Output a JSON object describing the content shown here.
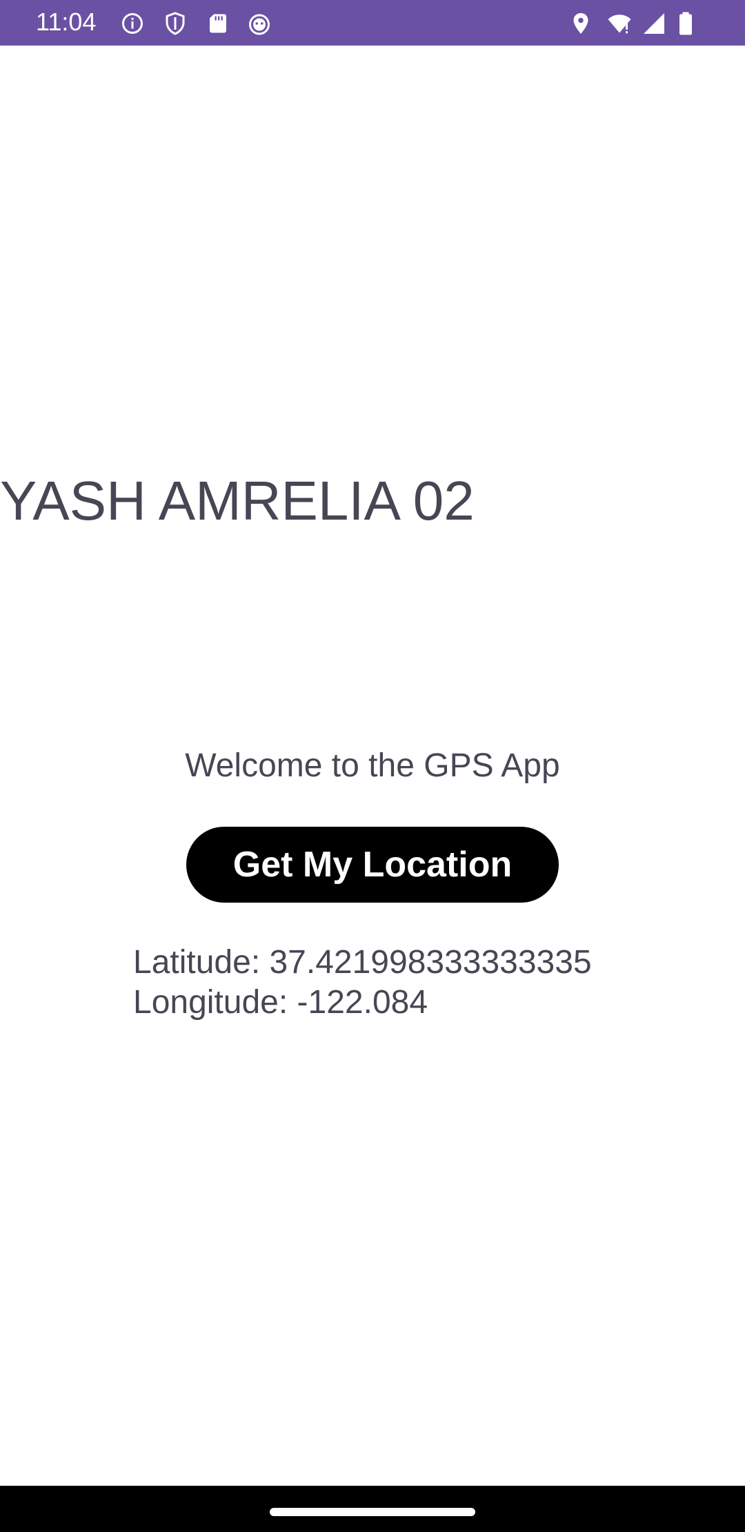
{
  "status_bar": {
    "time": "11:04",
    "left_icons": [
      "info-icon",
      "shield-icon",
      "sd-card-icon",
      "android-icon"
    ],
    "right_icons": [
      "location-icon",
      "wifi-icon",
      "signal-icon",
      "battery-icon"
    ],
    "background_color": "#6a51a3"
  },
  "main": {
    "title": "YASH AMRELIA 02",
    "welcome_text": "Welcome to the GPS App",
    "button_label": "Get My Location",
    "latitude_text": "Latitude: 37.421998333333335",
    "longitude_text": "Longitude: -122.084"
  },
  "colors": {
    "text": "#484654",
    "button_bg": "#000000",
    "button_text": "#ffffff"
  }
}
